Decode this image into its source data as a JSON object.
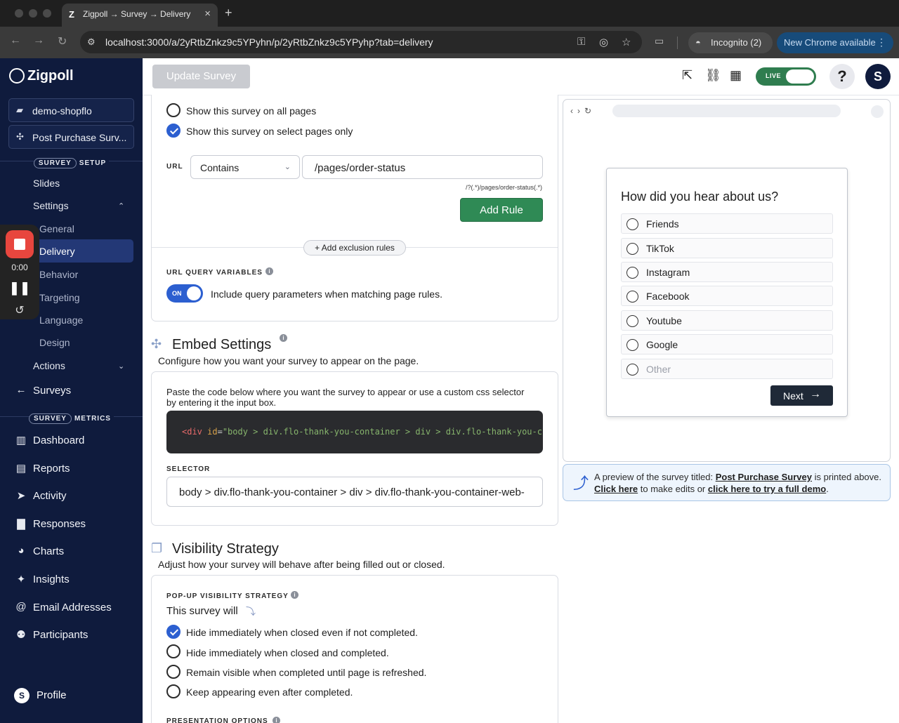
{
  "browser": {
    "tab_title": "Zigpoll → Survey → Delivery",
    "tab_favicon": "Z",
    "url": "localhost:3000/a/2yRtbZnkz9c5YPyhn/p/2yRtbZnkz9c5YPyhp?tab=delivery",
    "incognito": "Incognito (2)",
    "update_notice": "New Chrome available"
  },
  "sidebar": {
    "logo": "Zigpoll",
    "account": "demo-shopflo",
    "survey": "Post Purchase Surv...",
    "setup_section": {
      "pill": "SURVEY",
      "rest": "SETUP"
    },
    "setup_items": {
      "slides": "Slides",
      "settings": "Settings",
      "actions": "Actions"
    },
    "settings_sub": {
      "general": "General",
      "delivery": "Delivery",
      "behavior": "Behavior",
      "targeting": "Targeting",
      "language": "Language",
      "design": "Design"
    },
    "surveys_link": "Surveys",
    "metrics_section": {
      "pill": "SURVEY",
      "rest": "METRICS"
    },
    "metrics_items": {
      "dashboard": "Dashboard",
      "reports": "Reports",
      "activity": "Activity",
      "responses": "Responses",
      "charts": "Charts",
      "insights": "Insights",
      "email_addresses": "Email Addresses",
      "participants": "Participants"
    },
    "profile_initial": "S",
    "profile": "Profile"
  },
  "recorder": {
    "time": "0:00"
  },
  "topbar": {
    "update_button": "Update Survey",
    "live_label": "LIVE",
    "help": "?",
    "user_initial": "S"
  },
  "page_rules": {
    "option_all": "Show this survey on all pages",
    "option_select": "Show this survey on select pages only",
    "url_label": "URL",
    "match_type": "Contains",
    "url_value": "/pages/order-status",
    "regex": "/?(.*)/pages/order-status(.*)",
    "add_rule": "Add Rule",
    "add_exclusion": "+ Add exclusion rules",
    "query_vars_label": "URL QUERY VARIABLES",
    "query_toggle": "ON",
    "query_text": "Include query parameters when matching page rules."
  },
  "embed": {
    "title": "Embed Settings",
    "subtitle": "Configure how you want your survey to appear on the page.",
    "instructions": "Paste the code below where you want the survey to appear or use a custom css selector by entering it the input box.",
    "code": {
      "open": "<div",
      "attr": " id",
      "eq": "=",
      "value": "\"body > div.flo-thank-you-container > div > div.flo-thank-you-c"
    },
    "selector_label": "SELECTOR",
    "selector_value": "body > div.flo-thank-you-container > div > div.flo-thank-you-container-web-"
  },
  "visibility": {
    "title": "Visibility Strategy",
    "subtitle": "Adjust how your survey will behave after being filled out or closed.",
    "strategy_label": "POP-UP VISIBILITY STRATEGY",
    "lead": "This survey will",
    "options": {
      "hide_not_completed": "Hide immediately when closed even if not completed.",
      "hide_completed": "Hide immediately when closed and completed.",
      "remain_visible": "Remain visible when completed until page is refreshed.",
      "keep_appearing": "Keep appearing even after completed."
    },
    "presentation_label": "PRESENTATION OPTIONS"
  },
  "preview": {
    "question": "How did you hear about us?",
    "options": {
      "friends": "Friends",
      "tiktok": "TikTok",
      "instagram": "Instagram",
      "facebook": "Facebook",
      "youtube": "Youtube",
      "google": "Google",
      "other": "Other"
    },
    "next": "Next",
    "notice": {
      "a": "A preview of the survey titled: ",
      "survey_link": "Post Purchase Survey",
      "b": " is printed above. ",
      "edit_link": "Click here",
      "c": " to make edits or ",
      "demo_link": "click here to try a full demo",
      "d": "."
    }
  },
  "colors": {
    "sidebar_bg": "#0f1b3d",
    "accent_blue": "#2c5fd0",
    "success_green": "#2f8a55",
    "live_green": "#2f7d4f"
  },
  "icons": {
    "reload": "reload-icon",
    "site_settings": "tune-icon",
    "password": "key-icon",
    "eye_off": "eye-off-icon",
    "bookmark": "star-icon",
    "cast": "cast-icon",
    "open": "external-link-icon",
    "copy_link": "link-icon",
    "qr": "qr-code-icon"
  }
}
